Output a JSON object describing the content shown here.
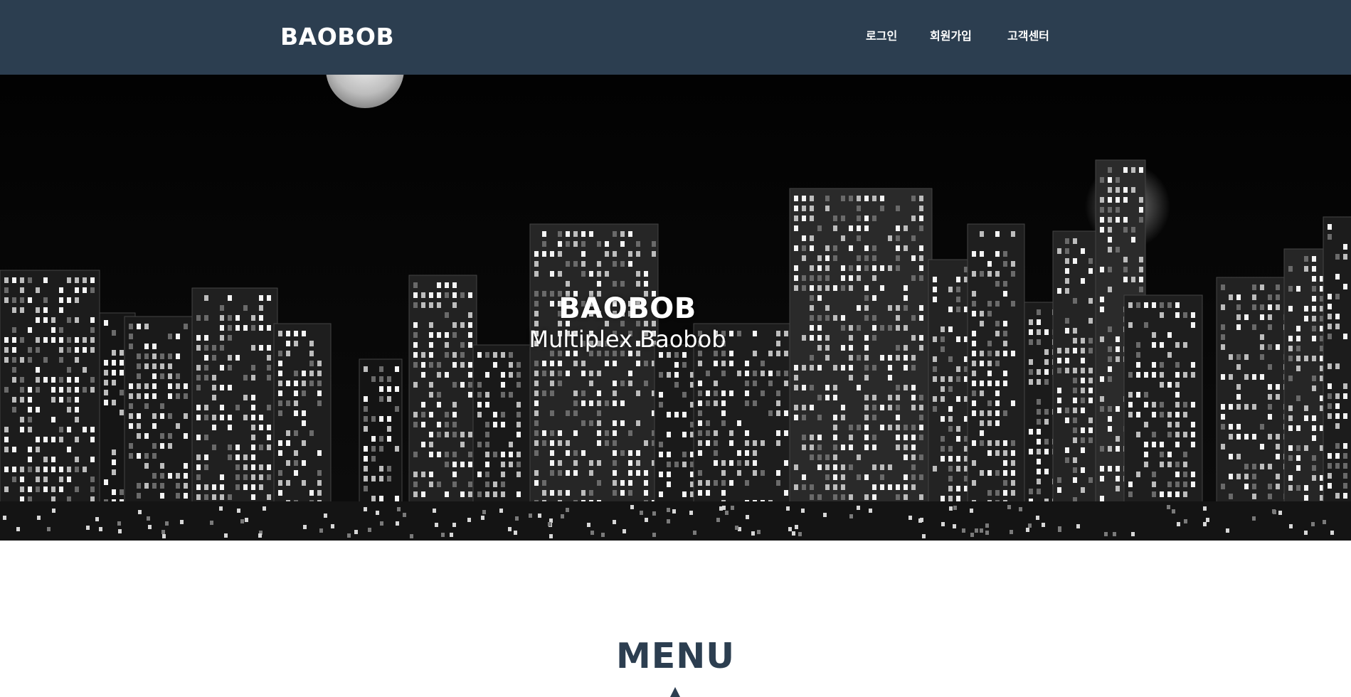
{
  "navbar": {
    "brand": "BAOBOB",
    "links": [
      {
        "label": "로그인"
      },
      {
        "label": "회원가입"
      },
      {
        "label": "고객센터"
      }
    ]
  },
  "hero": {
    "title": "BAOBOB",
    "subtitle": "Multiplex Baobob"
  },
  "menu_section": {
    "title": "MENU",
    "divider_icon": "star-icon"
  },
  "colors": {
    "navbar_bg": "#2c3e50",
    "heading": "#2c3e50",
    "hero_bg": "#000000",
    "text_light": "#ffffff"
  }
}
